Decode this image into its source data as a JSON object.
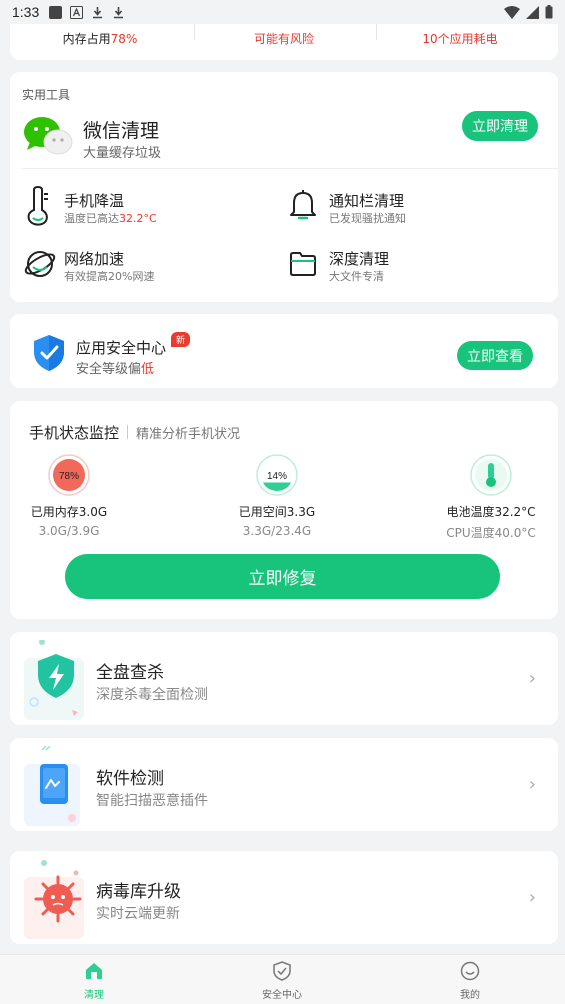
{
  "status_bar": {
    "time": "1:33"
  },
  "top_summary": {
    "memory_prefix": "内存占用",
    "memory_value": "78%",
    "risk": "可能有风险",
    "apps": "10个应用耗电"
  },
  "tools": {
    "section_title": "实用工具",
    "wechat": {
      "title": "微信清理",
      "subtitle": "大量缓存垃圾",
      "button": "立即清理"
    },
    "items": [
      {
        "title": "手机降温",
        "sub_prefix": "温度已高达",
        "sub_value": "32.2°C"
      },
      {
        "title": "通知栏清理",
        "sub": "已发现骚扰通知"
      },
      {
        "title": "网络加速",
        "sub": "有效提高20%网速"
      },
      {
        "title": "深度清理",
        "sub": "大文件专清"
      }
    ]
  },
  "security": {
    "title": "应用安全中心",
    "badge": "新",
    "sub_prefix": "安全等级偏",
    "sub_value": "低",
    "button": "立即查看"
  },
  "monitor": {
    "title": "手机状态监控",
    "subtitle": "精准分析手机状况",
    "memory": {
      "percent_label": "78%",
      "percent": 78,
      "line1": "已用内存3.0G",
      "line2": "3.0G/3.9G"
    },
    "storage": {
      "percent_label": "14%",
      "percent": 14,
      "line1": "已用空间3.3G",
      "line2": "3.3G/23.4G"
    },
    "battery": {
      "line1": "电池温度32.2°C",
      "line2": "CPU温度40.0°C"
    },
    "repair_button": "立即修复"
  },
  "features": [
    {
      "title": "全盘查杀",
      "subtitle": "深度杀毒全面检测"
    },
    {
      "title": "软件检测",
      "subtitle": "智能扫描恶意插件"
    },
    {
      "title": "病毒库升级",
      "subtitle": "实时云端更新"
    }
  ],
  "bottom_nav": [
    {
      "label": "清理",
      "active": true
    },
    {
      "label": "安全中心",
      "active": false
    },
    {
      "label": "我的",
      "active": false
    }
  ],
  "colors": {
    "accent": "#18c47c",
    "danger": "#e8382d",
    "warning": "#f0a30a"
  }
}
